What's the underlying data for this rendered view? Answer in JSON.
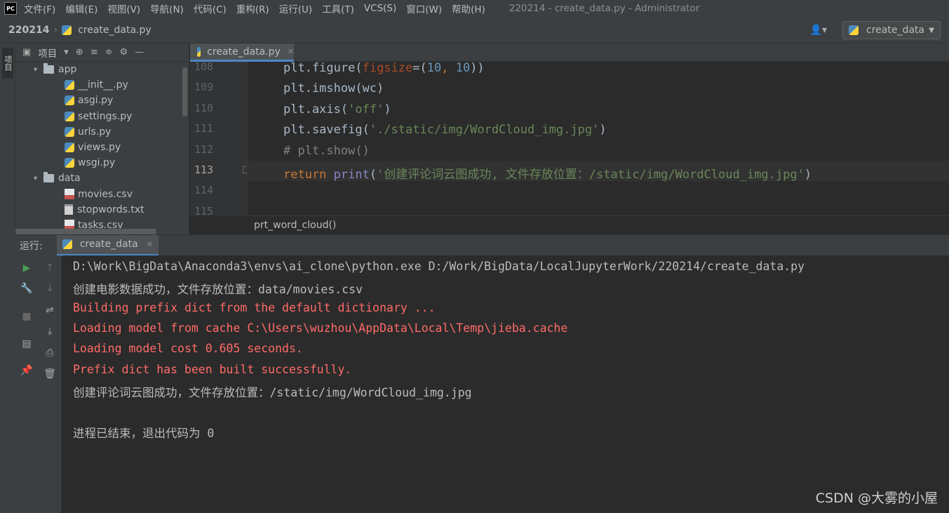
{
  "menubar": {
    "logo": "PC",
    "items": [
      "文件(F)",
      "编辑(E)",
      "视图(V)",
      "导航(N)",
      "代码(C)",
      "重构(R)",
      "运行(U)",
      "工具(T)",
      "VCS(S)",
      "窗口(W)",
      "帮助(H)"
    ],
    "window_title": "220214 - create_data.py - Administrator"
  },
  "navbar": {
    "project": "220214",
    "file": "create_data.py",
    "run_config": "create_data"
  },
  "left_stripe": {
    "project_tab": "项目"
  },
  "project_panel": {
    "title": "项目",
    "tree": [
      {
        "label": "app",
        "type": "folder",
        "level": 1
      },
      {
        "label": "__init__.py",
        "type": "py",
        "level": 2
      },
      {
        "label": "asgi.py",
        "type": "py",
        "level": 2
      },
      {
        "label": "settings.py",
        "type": "py",
        "level": 2
      },
      {
        "label": "urls.py",
        "type": "py",
        "level": 2
      },
      {
        "label": "views.py",
        "type": "py",
        "level": 2
      },
      {
        "label": "wsgi.py",
        "type": "py",
        "level": 2
      },
      {
        "label": "data",
        "type": "folder",
        "level": 1
      },
      {
        "label": "movies.csv",
        "type": "csv",
        "level": 2
      },
      {
        "label": "stopwords.txt",
        "type": "txt",
        "level": 2
      },
      {
        "label": "tasks.csv",
        "type": "csv",
        "level": 2
      }
    ]
  },
  "editor": {
    "tab": "create_data.py",
    "current_line": "113",
    "line_numbers": [
      "108",
      "109",
      "110",
      "111",
      "112",
      "113",
      "114",
      "115"
    ],
    "lines": [
      {
        "segments": [
          {
            "t": "plt.figure(",
            "c": "#a9b7c6"
          },
          {
            "t": "figsize",
            "c": "#aa4926"
          },
          {
            "t": "=(",
            "c": "#a9b7c6"
          },
          {
            "t": "10",
            "c": "#6897bb"
          },
          {
            "t": ", ",
            "c": "#cc7832"
          },
          {
            "t": "10",
            "c": "#6897bb"
          },
          {
            "t": "))",
            "c": "#a9b7c6"
          }
        ]
      },
      {
        "segments": [
          {
            "t": "plt.imshow(wc)",
            "c": "#a9b7c6"
          }
        ]
      },
      {
        "segments": [
          {
            "t": "plt.axis(",
            "c": "#a9b7c6"
          },
          {
            "t": "'off'",
            "c": "#6a8759"
          },
          {
            "t": ")",
            "c": "#a9b7c6"
          }
        ]
      },
      {
        "segments": [
          {
            "t": "plt.savefig(",
            "c": "#a9b7c6"
          },
          {
            "t": "'./static/img/WordCloud_img.jpg'",
            "c": "#6a8759"
          },
          {
            "t": ")",
            "c": "#a9b7c6"
          }
        ]
      },
      {
        "segments": [
          {
            "t": "# plt.show()",
            "c": "#808080"
          }
        ]
      },
      {
        "segments": [
          {
            "t": "return ",
            "c": "#cc7832"
          },
          {
            "t": "print",
            "c": "#8888c6"
          },
          {
            "t": "(",
            "c": "#a9b7c6"
          },
          {
            "t": "'创建评论词云图成功, 文件存放位置：/static/img/WordCloud_img.jpg'",
            "c": "#6a8759"
          },
          {
            "t": ")",
            "c": "#a9b7c6"
          }
        ]
      },
      {
        "segments": []
      },
      {
        "segments": []
      }
    ],
    "function_breadcrumb": "prt_word_cloud()"
  },
  "run_panel": {
    "label": "运行:",
    "tab": "create_data",
    "console": [
      {
        "text": "D:\\Work\\BigData\\Anaconda3\\envs\\ai_clone\\python.exe D:/Work/BigData/LocalJupyterWork/220214/create_data.py",
        "kind": "normal"
      },
      {
        "text": "创建电影数据成功，文件存放位置：data/movies.csv",
        "kind": "normal"
      },
      {
        "text": "Building prefix dict from the default dictionary ...",
        "kind": "err"
      },
      {
        "text": "Loading model from cache C:\\Users\\wuzhou\\AppData\\Local\\Temp\\jieba.cache",
        "kind": "err"
      },
      {
        "text": "Loading model cost 0.605 seconds.",
        "kind": "err"
      },
      {
        "text": "Prefix dict has been built successfully.",
        "kind": "err"
      },
      {
        "text": "创建评论词云图成功，文件存放位置：/static/img/WordCloud_img.jpg",
        "kind": "normal"
      },
      {
        "text": "",
        "kind": "normal"
      },
      {
        "text": "进程已结束，退出代码为 0",
        "kind": "normal"
      }
    ]
  },
  "watermark": "CSDN @大雾的小屋",
  "colors": {
    "background": "#2b2b2b",
    "panel": "#3c3f41",
    "error": "#ff6b68",
    "accent": "#4a88c7"
  }
}
